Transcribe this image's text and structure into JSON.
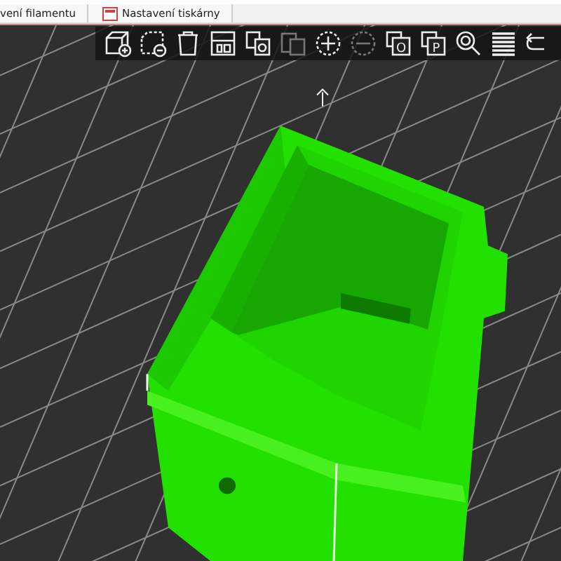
{
  "tabs": [
    {
      "label": "vení filamentu",
      "selected": false,
      "icon": false
    },
    {
      "label": "Nastavení tiskárny",
      "selected": false,
      "icon": true
    }
  ],
  "toolbar": [
    {
      "kind": "add"
    },
    {
      "kind": "delete"
    },
    {
      "kind": "delete_all"
    },
    {
      "kind": "arrange"
    },
    {
      "kind": "copy"
    },
    {
      "kind": "paste"
    },
    {
      "kind": "instance_add"
    },
    {
      "kind": "instance_remove"
    },
    {
      "kind": "split",
      "letter": "O"
    },
    {
      "kind": "split",
      "letter": "P"
    },
    {
      "kind": "search"
    },
    {
      "kind": "layers"
    },
    {
      "kind": "undo"
    }
  ]
}
